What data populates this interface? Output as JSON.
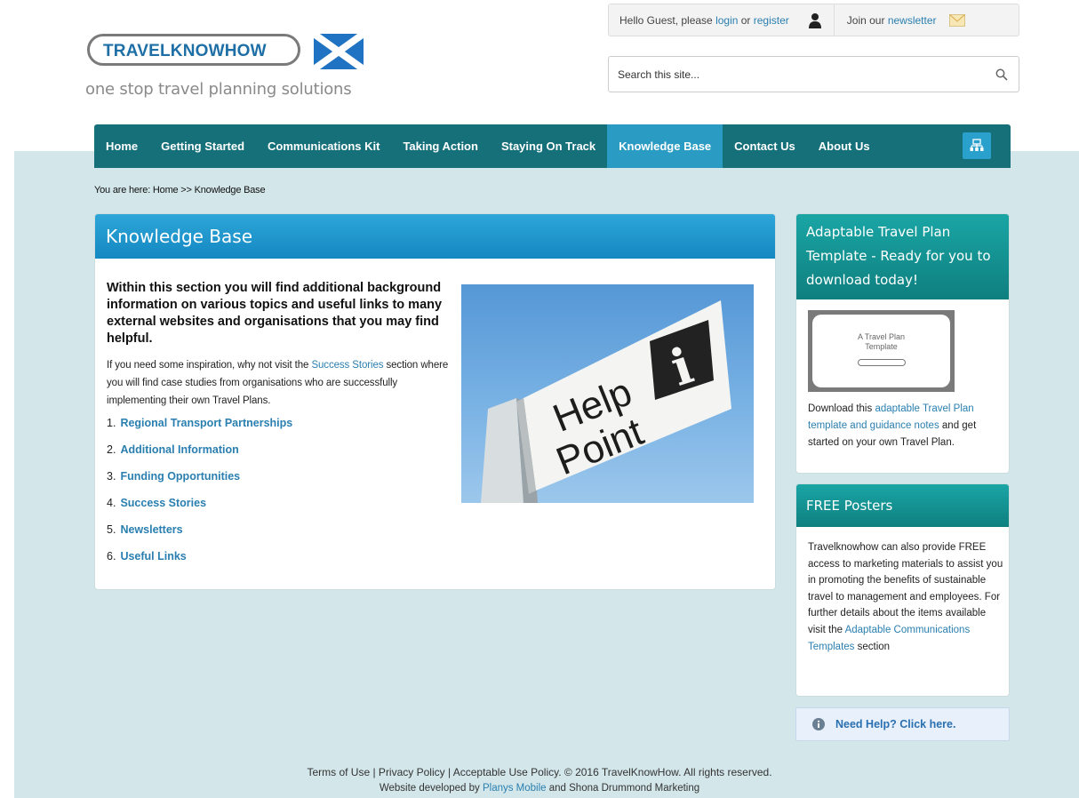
{
  "header": {
    "logo_text_a": "TRAVEL",
    "logo_text_b": "KNOW",
    "logo_text_c": "HOW",
    "tagline": "one stop travel planning solutions",
    "hello_prefix": "Hello Guest, please ",
    "login_label": "login",
    "or_text": " or ",
    "register_label": "register",
    "join_prefix": "Join our ",
    "newsletter_label": "newsletter",
    "search_placeholder": "Search this site..."
  },
  "nav": {
    "items": [
      {
        "label": "Home"
      },
      {
        "label": "Getting Started"
      },
      {
        "label": "Communications Kit"
      },
      {
        "label": "Taking Action"
      },
      {
        "label": "Staying On Track"
      },
      {
        "label": "Knowledge Base"
      },
      {
        "label": "Contact Us"
      },
      {
        "label": "About Us"
      }
    ],
    "active": "Knowledge Base"
  },
  "breadcrumb": {
    "prefix": "You are here: ",
    "home": "Home",
    "sep": " >> ",
    "current": "Knowledge Base"
  },
  "main": {
    "title": "Knowledge Base",
    "intro_bold": "Within this section you will find additional background information on various topics and useful links to many external websites and organisations that you may find helpful.",
    "intro_pre": "If you need some inspiration, why not visit the ",
    "intro_link": "Success Stories",
    "intro_post": " section where you will find case studies from organisations who are successfully implementing their own Travel Plans.",
    "links": [
      {
        "num": "1.",
        "label": "Regional Transport Partnerships"
      },
      {
        "num": "2.",
        "label": "Additional Information"
      },
      {
        "num": "3.",
        "label": "Funding Opportunities"
      },
      {
        "num": "4.",
        "label": "Success Stories"
      },
      {
        "num": "5.",
        "label": "Newsletters"
      },
      {
        "num": "6.",
        "label": "Useful Links"
      }
    ],
    "sign_line1": "Help",
    "sign_line2": "Point",
    "sign_i": "i"
  },
  "sidebar": {
    "box1": {
      "title": "Adaptable Travel Plan Template - Ready for you to download today!",
      "thumb_line1": "A Travel Plan",
      "thumb_line2": "Template",
      "text_pre": "Download this ",
      "text_link": "adaptable Travel Plan template and guidance notes",
      "text_post": "  and get started on your own Travel Plan."
    },
    "box2": {
      "title": "FREE Posters",
      "text_pre": "Travelknowhow can also provide FREE access to marketing materials to assist you in promoting the benefits of sustainable travel to management and employees. For further details about the items available visit the ",
      "text_link": "Adaptable Communications Templates",
      "text_post": " section"
    },
    "need_help": "Need Help? Click here."
  },
  "footer": {
    "line1": "Terms of Use | Privacy Policy | Acceptable Use Policy. © 2016 TravelKnowHow. All rights reserved.",
    "line2_pre": "Website developed by ",
    "line2_link": "Planys Mobile",
    "line2_post": " and Shona Drummond Marketing"
  },
  "colors": {
    "nav_bg": "#16707a",
    "nav_active": "#2a9bc2",
    "page_band": "#d3e6ea",
    "link": "#2a7fb0",
    "teal_head": "#0f7f7f"
  },
  "icons": {
    "user": "user-icon",
    "newsletter": "envelope-icon",
    "search": "search-icon",
    "sitemap": "sitemap-icon",
    "help": "info-icon"
  }
}
